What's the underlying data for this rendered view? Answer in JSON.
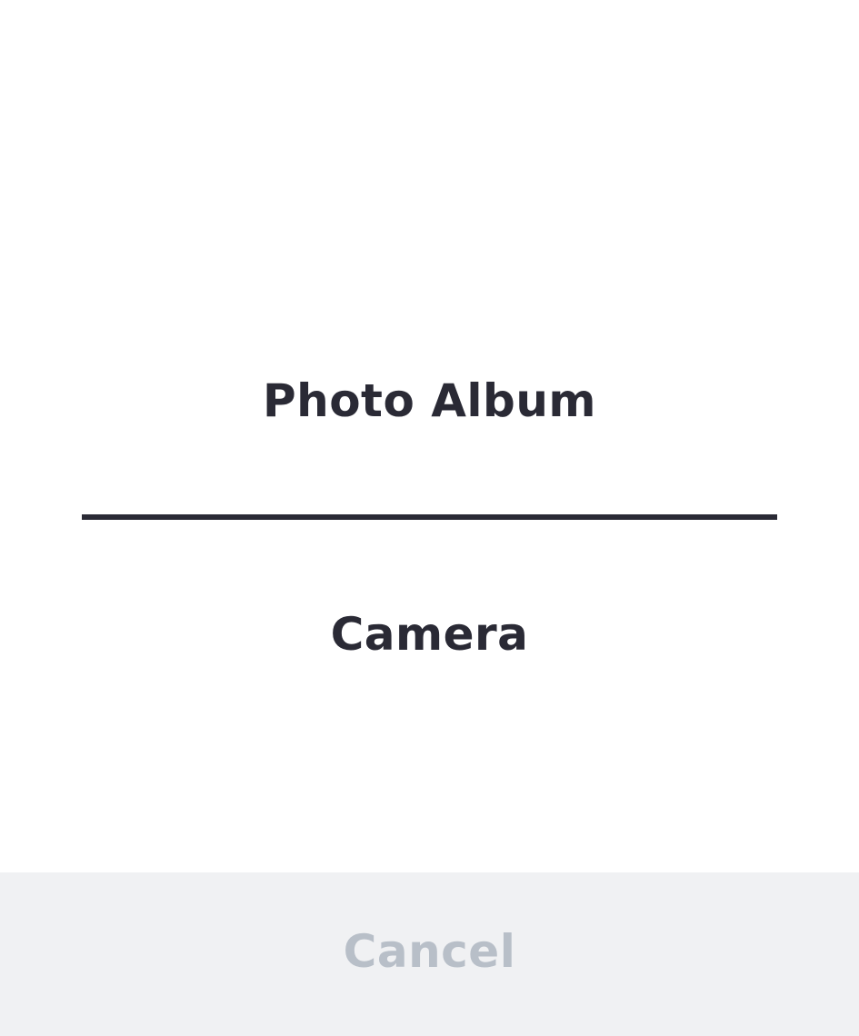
{
  "sheet": {
    "options": [
      {
        "label": "Photo Album"
      },
      {
        "label": "Camera"
      }
    ],
    "cancel_label": "Cancel"
  },
  "colors": {
    "text_primary": "#2a2a35",
    "divider": "#2a2a35",
    "cancel_background": "#f0f1f3",
    "cancel_text": "#b8bfc8",
    "background": "#ffffff"
  }
}
